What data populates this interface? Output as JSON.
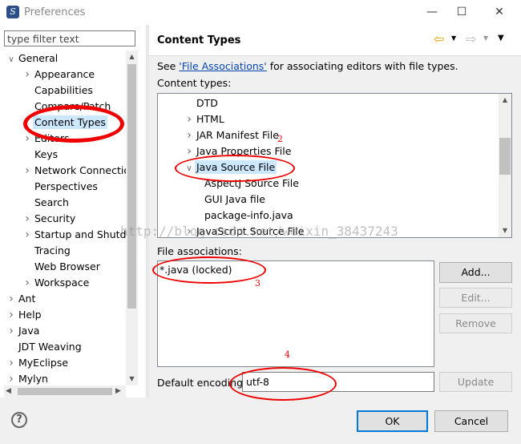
{
  "window": {
    "title": "Preferences",
    "app_icon_glyph": "S"
  },
  "filter": {
    "placeholder": "type filter text"
  },
  "tree": {
    "items": [
      {
        "label": "General",
        "indent": 0,
        "arrow": "expanded"
      },
      {
        "label": "Appearance",
        "indent": 1,
        "arrow": "collapsed"
      },
      {
        "label": "Capabilities",
        "indent": 1,
        "arrow": "none"
      },
      {
        "label": "Compare/Patch",
        "indent": 1,
        "arrow": "none"
      },
      {
        "label": "Content Types",
        "indent": 1,
        "arrow": "none",
        "selected": true
      },
      {
        "label": "Editors",
        "indent": 1,
        "arrow": "collapsed"
      },
      {
        "label": "Keys",
        "indent": 1,
        "arrow": "none"
      },
      {
        "label": "Network Connections",
        "indent": 1,
        "arrow": "collapsed"
      },
      {
        "label": "Perspectives",
        "indent": 1,
        "arrow": "none"
      },
      {
        "label": "Search",
        "indent": 1,
        "arrow": "none"
      },
      {
        "label": "Security",
        "indent": 1,
        "arrow": "collapsed"
      },
      {
        "label": "Startup and Shutdown",
        "indent": 1,
        "arrow": "collapsed"
      },
      {
        "label": "Tracing",
        "indent": 1,
        "arrow": "none"
      },
      {
        "label": "Web Browser",
        "indent": 1,
        "arrow": "none"
      },
      {
        "label": "Workspace",
        "indent": 1,
        "arrow": "collapsed"
      },
      {
        "label": "Ant",
        "indent": 0,
        "arrow": "collapsed"
      },
      {
        "label": "Help",
        "indent": 0,
        "arrow": "collapsed"
      },
      {
        "label": "Java",
        "indent": 0,
        "arrow": "collapsed"
      },
      {
        "label": "JDT Weaving",
        "indent": 0,
        "arrow": "none"
      },
      {
        "label": "MyEclipse",
        "indent": 0,
        "arrow": "collapsed"
      },
      {
        "label": "Mylyn",
        "indent": 0,
        "arrow": "collapsed"
      }
    ]
  },
  "page": {
    "title": "Content Types",
    "see_prefix": "See ",
    "see_link": "'File Associations'",
    "see_suffix": " for associating editors with file types.",
    "content_types_label": "Content types:",
    "file_assoc_label": "File associations:",
    "default_encoding_label": "Default encoding:",
    "default_encoding_value": "utf-8"
  },
  "content_types": [
    {
      "label": "DTD",
      "indent": 1,
      "arrow": "none"
    },
    {
      "label": "HTML",
      "indent": 1,
      "arrow": "collapsed"
    },
    {
      "label": "JAR Manifest File",
      "indent": 1,
      "arrow": "collapsed"
    },
    {
      "label": "Java Properties File",
      "indent": 1,
      "arrow": "collapsed"
    },
    {
      "label": "Java Source File",
      "indent": 1,
      "arrow": "expanded",
      "selected": true
    },
    {
      "label": "AspectJ Source File",
      "indent": 2,
      "arrow": "none"
    },
    {
      "label": "GUI Java file",
      "indent": 2,
      "arrow": "none"
    },
    {
      "label": "package-info.java",
      "indent": 2,
      "arrow": "none"
    },
    {
      "label": "JavaScript Source File",
      "indent": 1,
      "arrow": "collapsed"
    }
  ],
  "file_associations": [
    "*.java (locked)"
  ],
  "buttons": {
    "add": "Add...",
    "edit": "Edit...",
    "remove": "Remove",
    "update": "Update",
    "ok": "OK",
    "cancel": "Cancel"
  },
  "annotations": {
    "n2": "2",
    "n3": "3",
    "n4": "4"
  },
  "watermark": "http://blog.csdn.net/weixin_38437243",
  "colors": {
    "selection": "#cce8ff",
    "annotation": "#ee0000",
    "link": "#0645ad"
  }
}
